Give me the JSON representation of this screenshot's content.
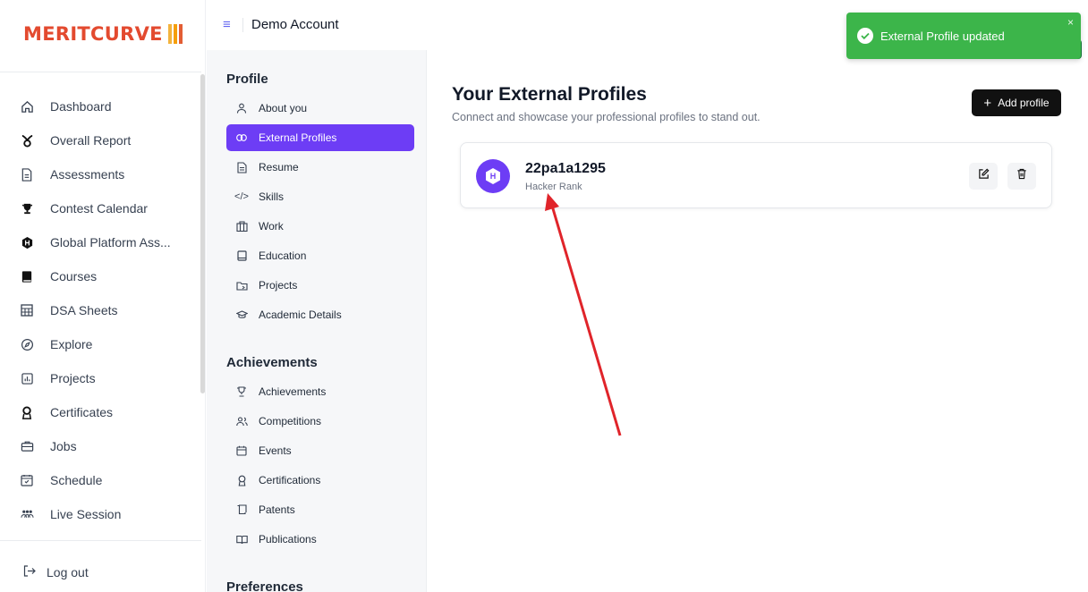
{
  "brand": {
    "name": "MERITCURVE"
  },
  "sidebar": {
    "items": [
      {
        "label": "Dashboard",
        "icon": "home-icon"
      },
      {
        "label": "Overall Report",
        "icon": "report-icon"
      },
      {
        "label": "Assessments",
        "icon": "document-icon"
      },
      {
        "label": "Contest Calendar",
        "icon": "trophy-icon"
      },
      {
        "label": "Global Platform Ass...",
        "icon": "hexagon-icon"
      },
      {
        "label": "Courses",
        "icon": "book-icon"
      },
      {
        "label": "DSA Sheets",
        "icon": "grid-icon"
      },
      {
        "label": "Explore",
        "icon": "compass-icon"
      },
      {
        "label": "Projects",
        "icon": "bar-chart-icon"
      },
      {
        "label": "Certificates",
        "icon": "award-icon"
      },
      {
        "label": "Jobs",
        "icon": "briefcase-icon"
      },
      {
        "label": "Schedule",
        "icon": "calendar-icon"
      },
      {
        "label": "Live Session",
        "icon": "people-icon"
      }
    ],
    "logout_label": "Log out"
  },
  "topbar": {
    "account": "Demo Account"
  },
  "submenu": {
    "profile_heading": "Profile",
    "profile_items": [
      {
        "label": "About you",
        "icon": "user-icon"
      },
      {
        "label": "External Profiles",
        "icon": "link-icon",
        "active": true
      },
      {
        "label": "Resume",
        "icon": "file-icon"
      },
      {
        "label": "Skills",
        "icon": "code-icon"
      },
      {
        "label": "Work",
        "icon": "building-icon"
      },
      {
        "label": "Education",
        "icon": "book-open-icon"
      },
      {
        "label": "Projects",
        "icon": "folder-icon"
      },
      {
        "label": "Academic Details",
        "icon": "graduation-cap-icon"
      }
    ],
    "achievements_heading": "Achievements",
    "achievement_items": [
      {
        "label": "Achievements",
        "icon": "trophy-icon"
      },
      {
        "label": "Competitions",
        "icon": "users-icon"
      },
      {
        "label": "Events",
        "icon": "calendar-icon"
      },
      {
        "label": "Certifications",
        "icon": "award-icon"
      },
      {
        "label": "Patents",
        "icon": "scroll-icon"
      },
      {
        "label": "Publications",
        "icon": "open-book-icon"
      }
    ],
    "preferences_heading": "Preferences"
  },
  "main": {
    "title": "Your External Profiles",
    "subtitle": "Connect and showcase your professional profiles to stand out.",
    "add_button": "Add profile",
    "profile_card": {
      "handle": "22pa1a1295",
      "platform": "Hacker Rank"
    }
  },
  "toast": {
    "message": "External Profile updated",
    "close": "×"
  },
  "colors": {
    "accent": "#6d3df5",
    "toast": "#3cb54a",
    "logo": "#e34a2f",
    "annotation_arrow": "#e0242a"
  }
}
